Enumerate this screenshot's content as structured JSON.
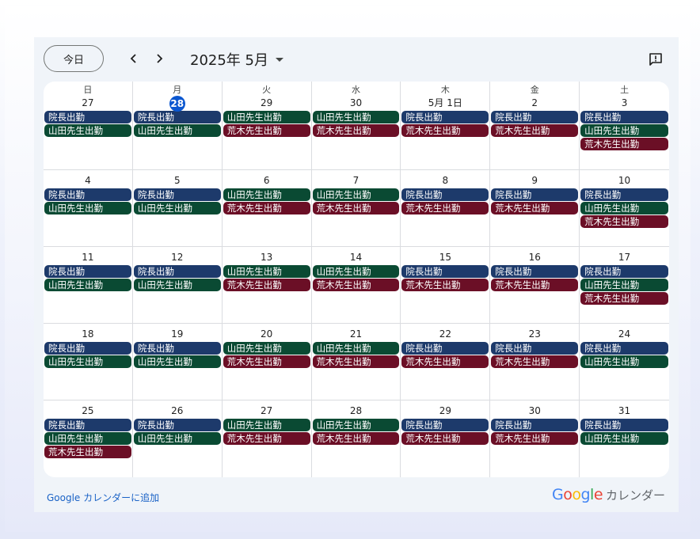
{
  "toolbar": {
    "today_label": "今日",
    "month_label": "2025年 5月"
  },
  "weekdays": [
    "日",
    "月",
    "火",
    "水",
    "木",
    "金",
    "土"
  ],
  "colors": {
    "navy": "#1d3a6b",
    "green": "#0a4a33",
    "maroon": "#6b0f26",
    "today": "#0b57d0"
  },
  "weeks": [
    [
      {
        "day": "27",
        "events": [
          {
            "t": "院長出勤",
            "c": "navy"
          },
          {
            "t": "山田先生出勤",
            "c": "green"
          }
        ]
      },
      {
        "day": "28",
        "today": true,
        "events": [
          {
            "t": "院長出勤",
            "c": "navy"
          },
          {
            "t": "山田先生出勤",
            "c": "green"
          }
        ]
      },
      {
        "day": "29",
        "events": [
          {
            "t": "山田先生出勤",
            "c": "green"
          },
          {
            "t": "荒木先生出勤",
            "c": "maroon"
          }
        ]
      },
      {
        "day": "30",
        "events": [
          {
            "t": "山田先生出勤",
            "c": "green"
          },
          {
            "t": "荒木先生出勤",
            "c": "maroon"
          }
        ]
      },
      {
        "day": "5月 1日",
        "events": [
          {
            "t": "院長出勤",
            "c": "navy"
          },
          {
            "t": "荒木先生出勤",
            "c": "maroon"
          }
        ]
      },
      {
        "day": "2",
        "events": [
          {
            "t": "院長出勤",
            "c": "navy"
          },
          {
            "t": "荒木先生出勤",
            "c": "maroon"
          }
        ]
      },
      {
        "day": "3",
        "events": [
          {
            "t": "院長出勤",
            "c": "navy"
          },
          {
            "t": "山田先生出勤",
            "c": "green"
          },
          {
            "t": "荒木先生出勤",
            "c": "maroon"
          }
        ]
      }
    ],
    [
      {
        "day": "4",
        "events": [
          {
            "t": "院長出勤",
            "c": "navy"
          },
          {
            "t": "山田先生出勤",
            "c": "green"
          }
        ]
      },
      {
        "day": "5",
        "events": [
          {
            "t": "院長出勤",
            "c": "navy"
          },
          {
            "t": "山田先生出勤",
            "c": "green"
          }
        ]
      },
      {
        "day": "6",
        "events": [
          {
            "t": "山田先生出勤",
            "c": "green"
          },
          {
            "t": "荒木先生出勤",
            "c": "maroon"
          }
        ]
      },
      {
        "day": "7",
        "events": [
          {
            "t": "山田先生出勤",
            "c": "green"
          },
          {
            "t": "荒木先生出勤",
            "c": "maroon"
          }
        ]
      },
      {
        "day": "8",
        "events": [
          {
            "t": "院長出勤",
            "c": "navy"
          },
          {
            "t": "荒木先生出勤",
            "c": "maroon"
          }
        ]
      },
      {
        "day": "9",
        "events": [
          {
            "t": "院長出勤",
            "c": "navy"
          },
          {
            "t": "荒木先生出勤",
            "c": "maroon"
          }
        ]
      },
      {
        "day": "10",
        "events": [
          {
            "t": "院長出勤",
            "c": "navy"
          },
          {
            "t": "山田先生出勤",
            "c": "green"
          },
          {
            "t": "荒木先生出勤",
            "c": "maroon"
          }
        ]
      }
    ],
    [
      {
        "day": "11",
        "events": [
          {
            "t": "院長出勤",
            "c": "navy"
          },
          {
            "t": "山田先生出勤",
            "c": "green"
          }
        ]
      },
      {
        "day": "12",
        "events": [
          {
            "t": "院長出勤",
            "c": "navy"
          },
          {
            "t": "山田先生出勤",
            "c": "green"
          }
        ]
      },
      {
        "day": "13",
        "events": [
          {
            "t": "山田先生出勤",
            "c": "green"
          },
          {
            "t": "荒木先生出勤",
            "c": "maroon"
          }
        ]
      },
      {
        "day": "14",
        "events": [
          {
            "t": "山田先生出勤",
            "c": "green"
          },
          {
            "t": "荒木先生出勤",
            "c": "maroon"
          }
        ]
      },
      {
        "day": "15",
        "events": [
          {
            "t": "院長出勤",
            "c": "navy"
          },
          {
            "t": "荒木先生出勤",
            "c": "maroon"
          }
        ]
      },
      {
        "day": "16",
        "events": [
          {
            "t": "院長出勤",
            "c": "navy"
          },
          {
            "t": "荒木先生出勤",
            "c": "maroon"
          }
        ]
      },
      {
        "day": "17",
        "events": [
          {
            "t": "院長出勤",
            "c": "navy"
          },
          {
            "t": "山田先生出勤",
            "c": "green"
          },
          {
            "t": "荒木先生出勤",
            "c": "maroon"
          }
        ]
      }
    ],
    [
      {
        "day": "18",
        "events": [
          {
            "t": "院長出勤",
            "c": "navy"
          },
          {
            "t": "山田先生出勤",
            "c": "green"
          }
        ]
      },
      {
        "day": "19",
        "events": [
          {
            "t": "院長出勤",
            "c": "navy"
          },
          {
            "t": "山田先生出勤",
            "c": "green"
          }
        ]
      },
      {
        "day": "20",
        "events": [
          {
            "t": "山田先生出勤",
            "c": "green"
          },
          {
            "t": "荒木先生出勤",
            "c": "maroon"
          }
        ]
      },
      {
        "day": "21",
        "events": [
          {
            "t": "山田先生出勤",
            "c": "green"
          },
          {
            "t": "荒木先生出勤",
            "c": "maroon"
          }
        ]
      },
      {
        "day": "22",
        "events": [
          {
            "t": "院長出勤",
            "c": "navy"
          },
          {
            "t": "荒木先生出勤",
            "c": "maroon"
          }
        ]
      },
      {
        "day": "23",
        "events": [
          {
            "t": "院長出勤",
            "c": "navy"
          },
          {
            "t": "荒木先生出勤",
            "c": "maroon"
          }
        ]
      },
      {
        "day": "24",
        "events": [
          {
            "t": "院長出勤",
            "c": "navy"
          },
          {
            "t": "山田先生出勤",
            "c": "green"
          }
        ]
      }
    ],
    [
      {
        "day": "25",
        "events": [
          {
            "t": "院長出勤",
            "c": "navy"
          },
          {
            "t": "山田先生出勤",
            "c": "green"
          },
          {
            "t": "荒木先生出勤",
            "c": "maroon"
          }
        ]
      },
      {
        "day": "26",
        "events": [
          {
            "t": "院長出勤",
            "c": "navy"
          },
          {
            "t": "山田先生出勤",
            "c": "green"
          }
        ]
      },
      {
        "day": "27",
        "events": [
          {
            "t": "山田先生出勤",
            "c": "green"
          },
          {
            "t": "荒木先生出勤",
            "c": "maroon"
          }
        ]
      },
      {
        "day": "28",
        "events": [
          {
            "t": "山田先生出勤",
            "c": "green"
          },
          {
            "t": "荒木先生出勤",
            "c": "maroon"
          }
        ]
      },
      {
        "day": "29",
        "events": [
          {
            "t": "院長出勤",
            "c": "navy"
          },
          {
            "t": "荒木先生出勤",
            "c": "maroon"
          }
        ]
      },
      {
        "day": "30",
        "events": [
          {
            "t": "院長出勤",
            "c": "navy"
          },
          {
            "t": "荒木先生出勤",
            "c": "maroon"
          }
        ]
      },
      {
        "day": "31",
        "events": [
          {
            "t": "院長出勤",
            "c": "navy"
          },
          {
            "t": "山田先生出勤",
            "c": "green"
          }
        ]
      }
    ]
  ],
  "footer": {
    "add_link": "Google カレンダーに追加",
    "brand_google": "Google",
    "brand_calendar": "カレンダー"
  }
}
